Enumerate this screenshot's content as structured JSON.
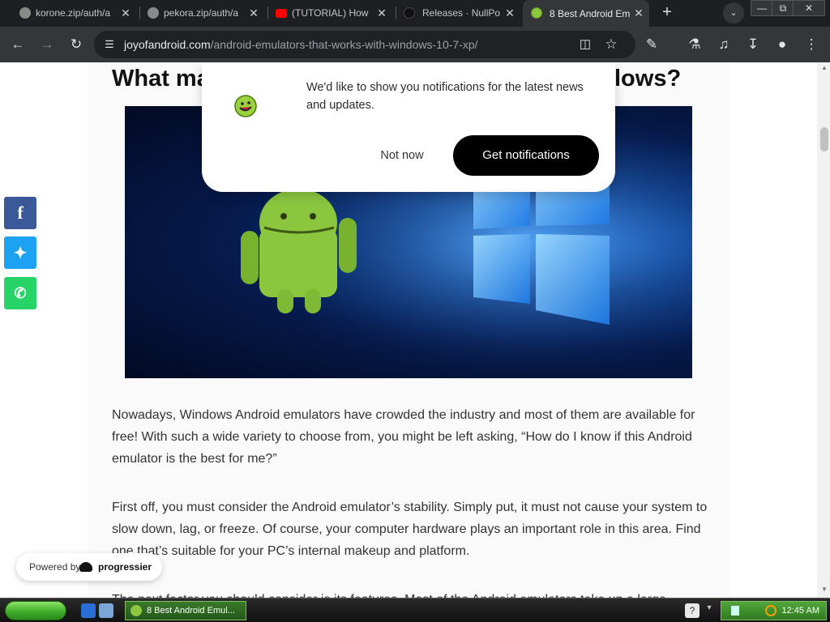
{
  "tabs": [
    {
      "title": "korone.zip/auth/a",
      "close": "✕",
      "icon": "globe-icon"
    },
    {
      "title": "pekora.zip/auth/a",
      "close": "✕",
      "icon": "globe-icon"
    },
    {
      "title": "(TUTORIAL) How",
      "close": "✕",
      "icon": "youtube-icon"
    },
    {
      "title": "Releases · NullPo",
      "close": "✕",
      "icon": "github-icon"
    },
    {
      "title": "8 Best Android Em",
      "close": "✕",
      "icon": "smiley-icon",
      "active": true
    }
  ],
  "toolbar": {
    "url_host": "joyofandroid.com",
    "url_path": "/android-emulators-that-works-with-windows-10-7-xp/"
  },
  "article": {
    "heading_start": "What ma",
    "heading_end": "lows?",
    "paragraphs": [
      "Nowadays, Windows Android emulators have crowded the industry and most of them are available for free! With such a wide variety to choose from, you might be left asking, “How do I know if this Android emulator is the best for me?”",
      "First off, you must consider the Android emulator’s stability. Simply put, it must not cause your system to slow down, lag, or freeze. Of course, your computer hardware plays an important role in this area. Find one that’s suitable for your PC’s internal makeup and platform.",
      "The next factor you should consider is its features. Most of the Android emulators take up a large"
    ]
  },
  "social": [
    {
      "name": "facebook",
      "glyph": "f",
      "color": "#3b5998"
    },
    {
      "name": "twitter",
      "glyph": "t",
      "color": "#1da1f2"
    },
    {
      "name": "whatsapp",
      "glyph": "w",
      "color": "#25d366"
    }
  ],
  "popup": {
    "message": "We'd like to show you notifications for the latest news and updates.",
    "not_now": "Not now",
    "get": "Get notifications"
  },
  "powered": {
    "label": "Powered by",
    "brand": "progressier"
  },
  "taskbar": {
    "task_title": "8 Best Android Emul...",
    "time": "12:45 AM"
  }
}
